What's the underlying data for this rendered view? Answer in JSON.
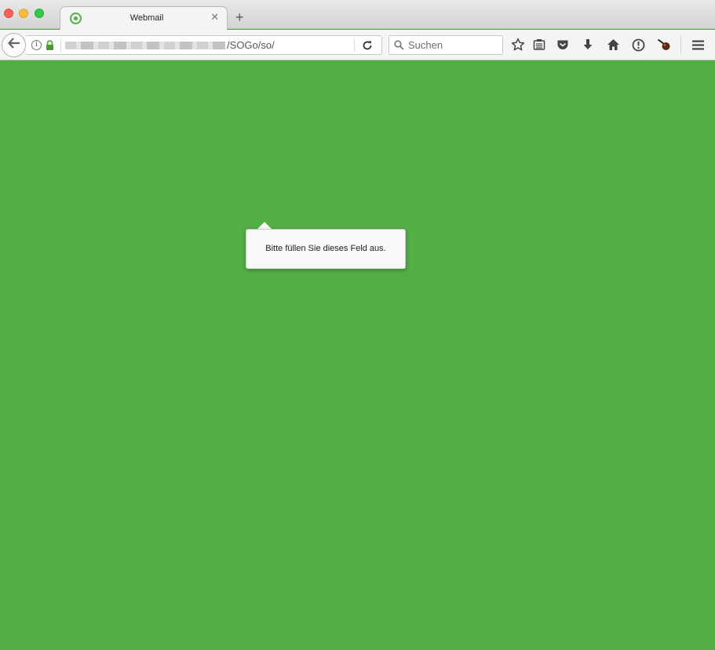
{
  "window": {
    "tab": {
      "title": "Webmail",
      "close_glyph": "✕"
    },
    "new_tab_glyph": "+"
  },
  "navbar": {
    "url_path": "/SOGo/so/",
    "search": {
      "placeholder": "Suchen"
    }
  },
  "toolbar_icons": [
    "bookmark-star-icon",
    "reading-list-icon",
    "pocket-icon",
    "download-icon",
    "home-icon",
    "warning-icon",
    "extension-icon",
    "menu-icon"
  ],
  "content": {
    "background_color": "#53b046",
    "validation_tooltip": "Bitte füllen Sie dieses Feld aus."
  }
}
